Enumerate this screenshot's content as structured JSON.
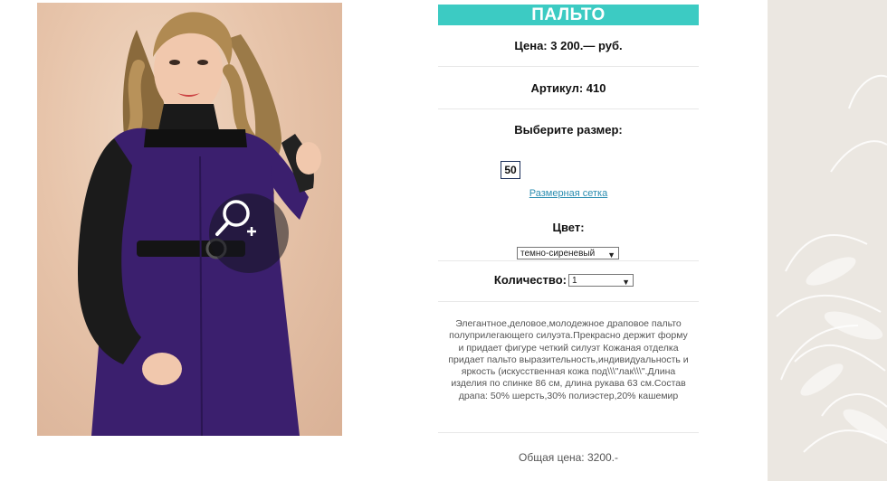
{
  "product": {
    "title": "ПАЛЬТО",
    "price": "Цена: 3 200.— руб.",
    "article": "Артикул: 410",
    "size_label": "Выберите размер:",
    "size_value": "50",
    "size_chart_link": "Размерная сетка",
    "color_label": "Цвет:",
    "color_selected": "темно-сиреневый",
    "quantity_label": "Количество:",
    "quantity_selected": "1",
    "description": "Элегантное,деловое,молодежное драповое пальто полуприлегающего силуэта.Прекрасно держит форму и придает фигуре четкий силуэт Кожаная отделка придает пальто выразительность,индивидуальность и яркость (искусственная кожа под\\\\\\\"лак\\\\\\\".Длина изделия по спинке 86 см, длина рукава 63 см.Состав драпа: 50% шерсть,30% полиэстер,20% кашемир",
    "total": "Общая цена: 3200.-"
  },
  "icons": {
    "zoom": "magnify-plus-icon"
  },
  "colors": {
    "accent": "#3ccbc3",
    "link": "#2a8db0",
    "coat": "#3b1f6e"
  }
}
